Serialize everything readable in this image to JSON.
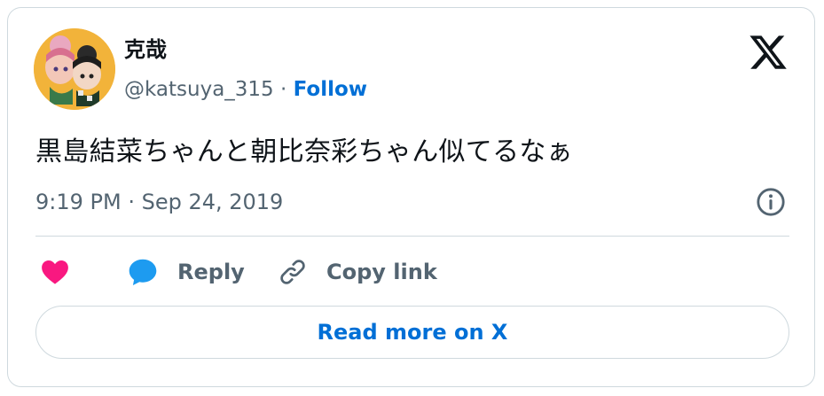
{
  "author": {
    "name": "克哉",
    "handle": "@katsuya_315",
    "separator": " · ",
    "follow_label": "Follow"
  },
  "tweet": {
    "text": "黒島結菜ちゃんと朝比奈彩ちゃん似てるなぁ",
    "timestamp": "9:19 PM · Sep 24, 2019"
  },
  "actions": {
    "reply_label": "Reply",
    "copy_link_label": "Copy link"
  },
  "read_more_label": "Read more on X",
  "colors": {
    "text_primary": "#0f1419",
    "text_secondary": "#536471",
    "link_blue": "#006fd6",
    "like_pink": "#f91880",
    "reply_blue": "#1d9bf0",
    "border": "#cfd9de"
  },
  "icons": {
    "platform": "x-logo-icon",
    "info": "info-icon",
    "like": "heart-icon",
    "reply": "speech-bubble-icon",
    "copy": "link-icon"
  }
}
